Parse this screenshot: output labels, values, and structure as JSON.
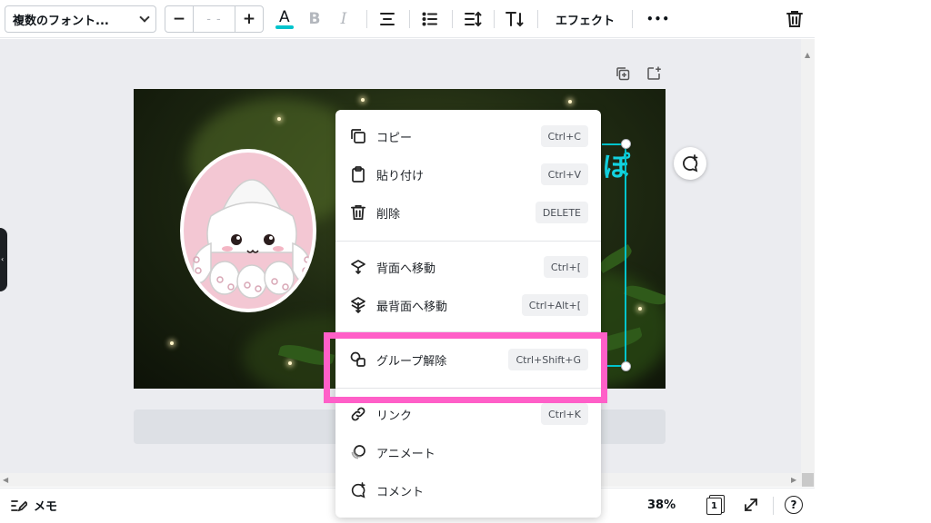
{
  "toolbar": {
    "font_name": "複数のフォント...",
    "size_minus": "−",
    "size_value": "- -",
    "size_plus": "+",
    "text_color_label": "A",
    "bold_label": "B",
    "italic_label": "I",
    "effects_label": "エフェクト",
    "more_label": "•••",
    "text_color_underline": "#00c4cc"
  },
  "context_menu": {
    "items": [
      {
        "label": "コピー",
        "shortcut": "Ctrl+C"
      },
      {
        "label": "貼り付け",
        "shortcut": "Ctrl+V"
      },
      {
        "label": "削除",
        "shortcut": "DELETE"
      },
      {
        "label": "背面へ移動",
        "shortcut": "Ctrl+["
      },
      {
        "label": "最背面へ移動",
        "shortcut": "Ctrl+Alt+["
      },
      {
        "label": "グループ解除",
        "shortcut": "Ctrl+Shift+G"
      },
      {
        "label": "リンク",
        "shortcut": "Ctrl+K"
      },
      {
        "label": "アニメート",
        "shortcut": ""
      },
      {
        "label": "コメント",
        "shortcut": ""
      }
    ]
  },
  "canvas": {
    "text_fragment": "ぽ",
    "highlight_color": "#ff5fc8",
    "selection_color": "#00c4cc"
  },
  "bottombar": {
    "memo_label": "メモ",
    "zoom": "38%",
    "page_number": "1",
    "help_label": "?"
  }
}
